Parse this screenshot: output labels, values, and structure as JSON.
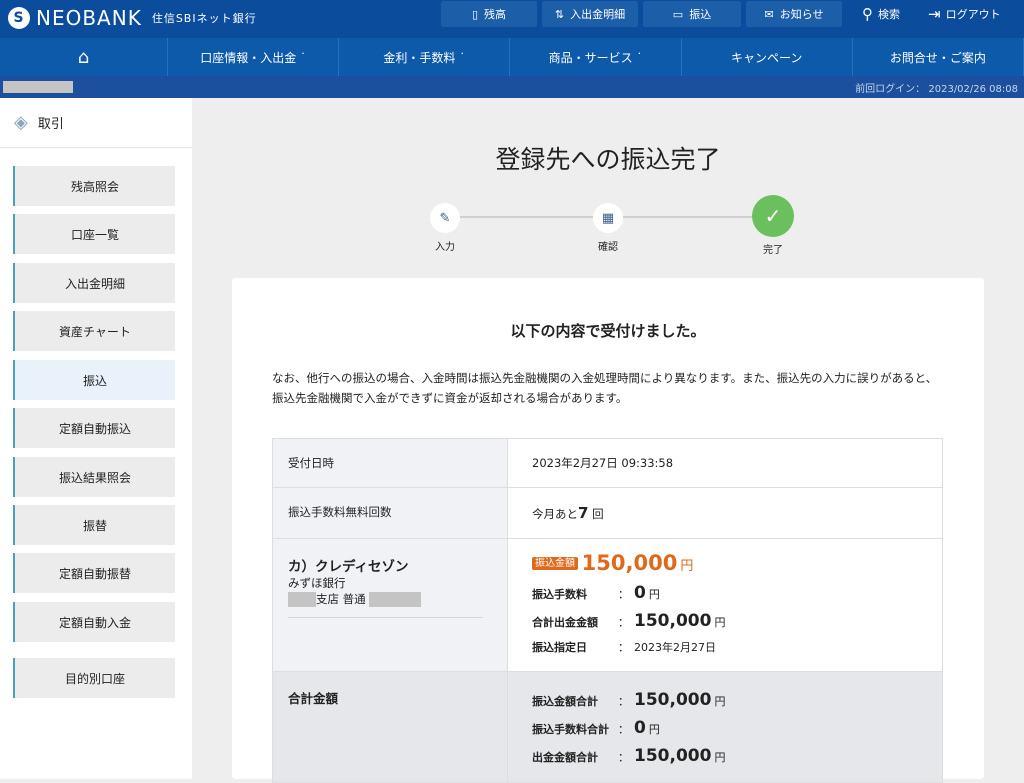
{
  "header": {
    "logo_mark": "S",
    "brand": "NEOBANK",
    "brand_sub": "住信SBIネット銀行",
    "buttons": [
      {
        "label": "残高",
        "icon": "phone-icon"
      },
      {
        "label": "入出金明細",
        "icon": "statement-icon"
      },
      {
        "label": "振込",
        "icon": "transfer-icon"
      },
      {
        "label": "お知らせ",
        "icon": "mail-icon"
      }
    ],
    "search": "検索",
    "logout": "ログアウト"
  },
  "nav": {
    "home_icon": "⌂",
    "items": [
      "口座情報・入出金 ˙",
      "金利・手数料 ˙",
      "商品・サービス ˙",
      "キャンペーン",
      "お問合せ・ご案内"
    ]
  },
  "last_login": "前回ログイン： 2023/02/26 08:08",
  "sidebar": {
    "title": "取引",
    "items": [
      "残高照会",
      "口座一覧",
      "入出金明細",
      "資産チャート",
      "振込",
      "定額自動振込",
      "振込結果照会",
      "振替",
      "定額自動振替",
      "定額自動入金",
      "目的別口座"
    ],
    "active": "振込"
  },
  "page_title": "登録先への振込完了",
  "steps": [
    {
      "label": "入力",
      "icon": "✎"
    },
    {
      "label": "確認",
      "icon": "▦"
    },
    {
      "label": "完了",
      "icon": "✓"
    }
  ],
  "card": {
    "heading": "以下の内容で受付けました。",
    "note": "なお、他行への振込の場合、入金時間は振込先金融機関の入金処理時間により異なります。また、振込先の入力に誤りがあると、振込先金融機関で入金ができずに資金が返却される場合があります。",
    "rows": {
      "date_label": "受付日時",
      "date_value": "2023年2月27日 09:33:58",
      "free_label": "振込手数料無料回数",
      "free_prefix": "今月あと",
      "free_count": "7",
      "free_suffix": "回",
      "payee_name": "カ）クレディセゾン",
      "payee_bank": "みずほ銀行",
      "payee_branch": "支店 普通",
      "amount_badge": "振込金額",
      "amount": "150,000",
      "yen": "円",
      "fee_label": "振込手数料",
      "fee": "0",
      "total_label": "合計出金金額",
      "total": "150,000",
      "date2_label": "振込指定日",
      "date2": "2023年2月27日",
      "sum_label": "合計金額",
      "sum_amount_label": "振込金額合計",
      "sum_amount": "150,000",
      "sum_fee_label": "振込手数料合計",
      "sum_fee": "0",
      "sum_out_label": "出金金額合計",
      "sum_out": "150,000",
      "colon": "："
    }
  },
  "colors": {
    "header": "#0b4c9c",
    "accent": "#e06a1b",
    "done": "#6cbf5e"
  }
}
